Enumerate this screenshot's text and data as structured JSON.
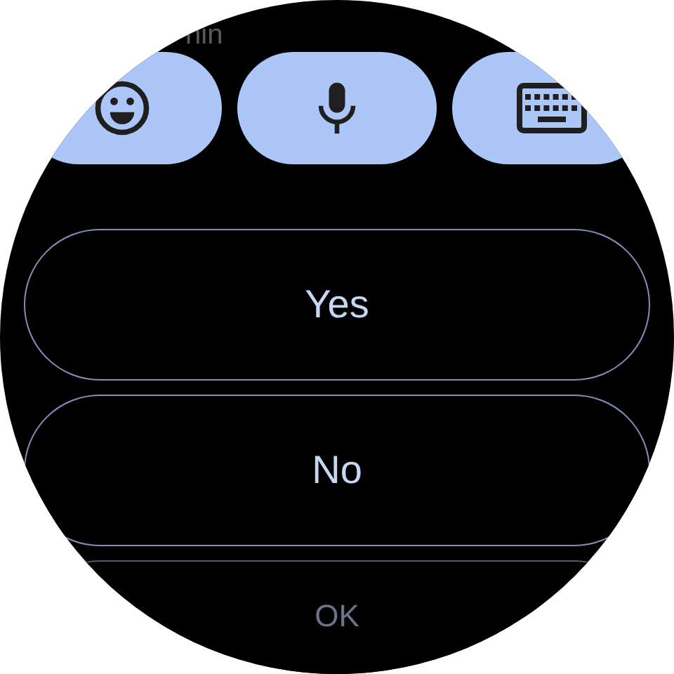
{
  "header": {
    "text": "nin"
  },
  "quick_actions": [
    {
      "kind": "emoji"
    },
    {
      "kind": "voice"
    },
    {
      "kind": "keyboard"
    }
  ],
  "replies": [
    {
      "label": "Yes",
      "dimmed": false
    },
    {
      "label": "No",
      "dimmed": false
    },
    {
      "label": "OK",
      "dimmed": true
    }
  ]
}
